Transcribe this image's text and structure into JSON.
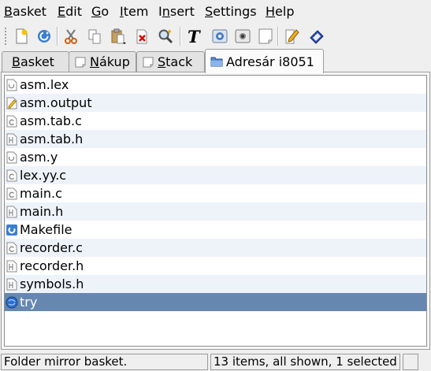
{
  "menubar": {
    "items": [
      {
        "label": "Basket",
        "accel": "B"
      },
      {
        "label": "Edit",
        "accel": "E"
      },
      {
        "label": "Go",
        "accel": "G"
      },
      {
        "label": "Item",
        "accel": "I"
      },
      {
        "label": "Insert",
        "accel": "n"
      },
      {
        "label": "Settings",
        "accel": "S"
      },
      {
        "label": "Help",
        "accel": "H"
      }
    ]
  },
  "toolbar": {
    "buttons": [
      "new-basket-icon",
      "reload-icon",
      "cut-icon",
      "copy-icon",
      "paste-icon",
      "delete-icon",
      "find-icon",
      "insert-text-icon",
      "insert-image-icon",
      "screenshot-icon",
      "new-note-icon",
      "edit-icon",
      "link-icon"
    ]
  },
  "tabs": [
    {
      "label": "Basket",
      "accel": "B",
      "icon": "none",
      "active": false
    },
    {
      "label": "Nákup",
      "accel": "N",
      "icon": "note-icon",
      "active": false
    },
    {
      "label": "Stack",
      "accel": "S",
      "icon": "note-icon",
      "active": false
    },
    {
      "label": "Adresár i8051",
      "accel": "",
      "icon": "folder-icon",
      "active": true
    }
  ],
  "files": [
    {
      "name": "asm.lex",
      "icon": "source-file-icon",
      "selected": false
    },
    {
      "name": "asm.output",
      "icon": "text-file-icon",
      "selected": false
    },
    {
      "name": "asm.tab.c",
      "icon": "c-source-icon",
      "selected": false
    },
    {
      "name": "asm.tab.h",
      "icon": "header-file-icon",
      "selected": false
    },
    {
      "name": "asm.y",
      "icon": "source-file-icon",
      "selected": false
    },
    {
      "name": "lex.yy.c",
      "icon": "c-source-icon",
      "selected": false
    },
    {
      "name": "main.c",
      "icon": "c-source-icon",
      "selected": false
    },
    {
      "name": "main.h",
      "icon": "header-file-icon",
      "selected": false
    },
    {
      "name": "Makefile",
      "icon": "makefile-icon",
      "selected": false
    },
    {
      "name": "recorder.c",
      "icon": "c-source-icon",
      "selected": false
    },
    {
      "name": "recorder.h",
      "icon": "header-file-icon",
      "selected": false
    },
    {
      "name": "symbols.h",
      "icon": "header-file-icon",
      "selected": false
    },
    {
      "name": "try",
      "icon": "executable-icon",
      "selected": true
    }
  ],
  "statusbar": {
    "message": "Folder mirror basket.",
    "items_info": "13 items, all shown, 1 selected",
    "extra": ""
  },
  "colors": {
    "selection": "#6688b0",
    "alternate_row": "#eef3fa",
    "window_bg": "#efefef"
  }
}
